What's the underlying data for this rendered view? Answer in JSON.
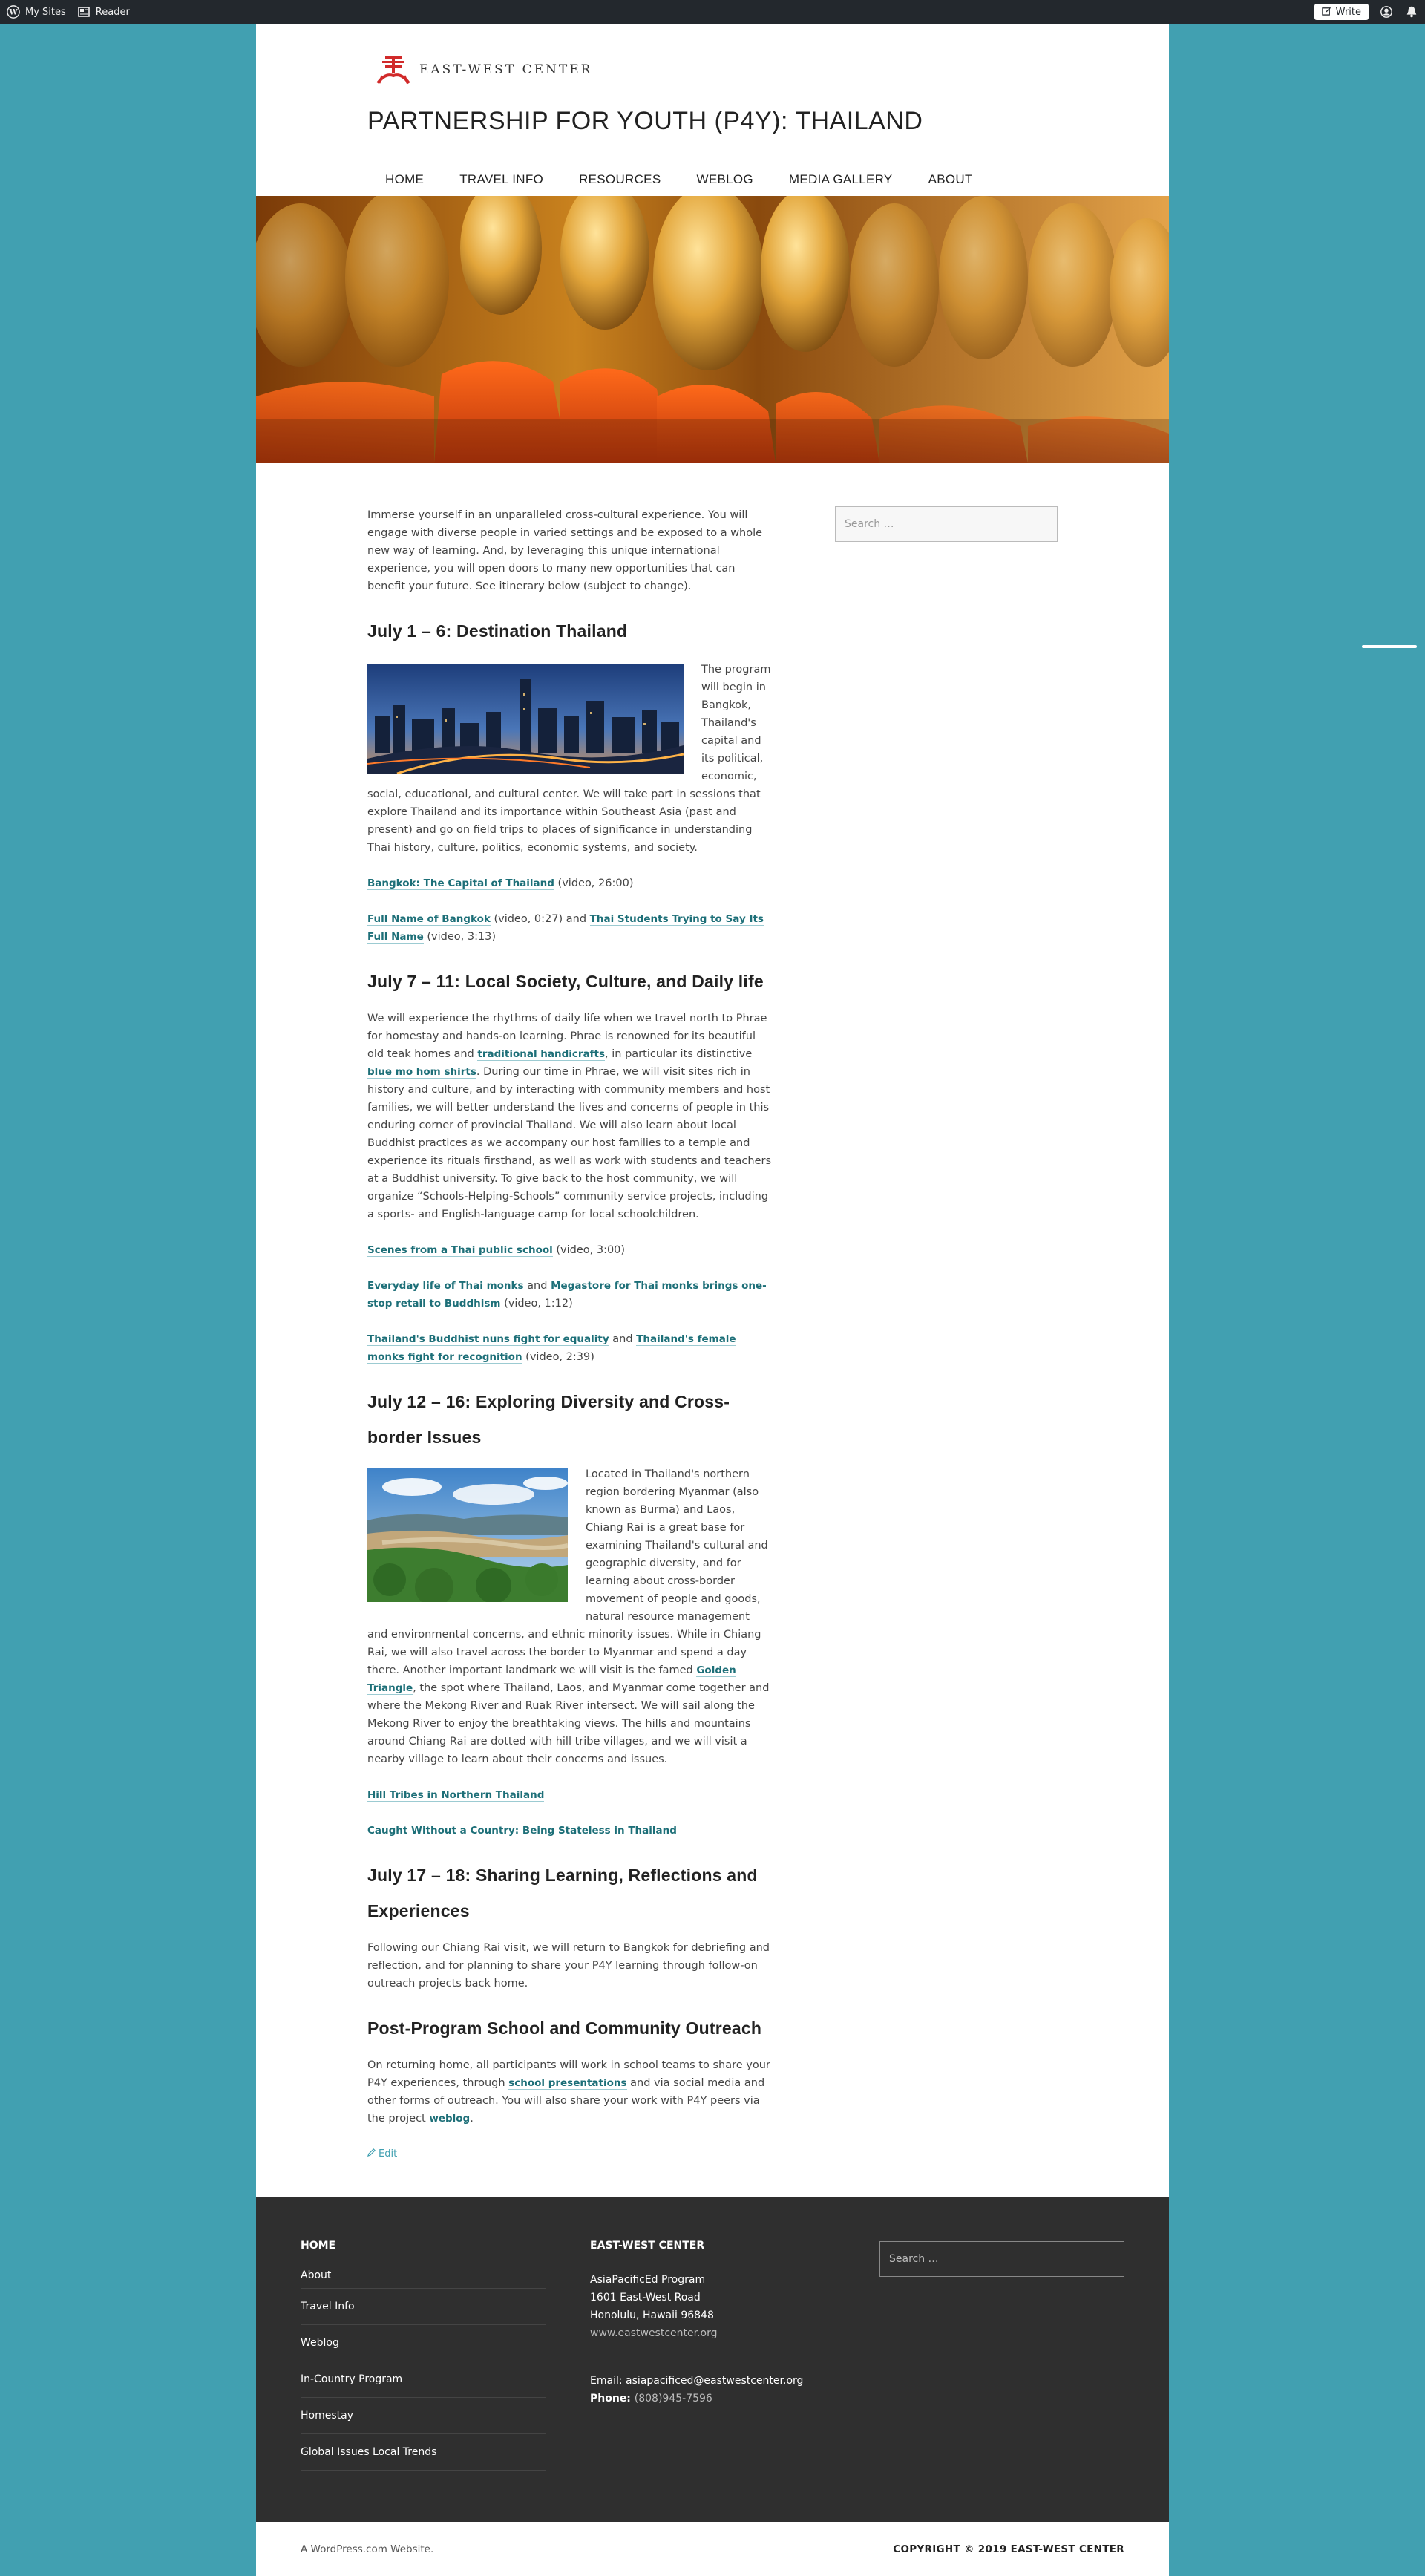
{
  "adminbar": {
    "my_sites": "My Sites",
    "reader": "Reader",
    "write": "Write"
  },
  "header": {
    "logo_text": "EAST-WEST CENTER",
    "site_title": "PARTNERSHIP FOR YOUTH (P4Y): THAILAND",
    "nav": [
      "HOME",
      "TRAVEL INFO",
      "RESOURCES",
      "WEBLOG",
      "MEDIA GALLERY",
      "ABOUT"
    ]
  },
  "content": {
    "intro": "Immerse yourself in an unparalleled cross-cultural experience. You will engage with diverse people in varied settings and be exposed to a whole new way of learning. And, by leveraging this unique international experience, you will open doors to many new opportunities that can benefit your future. See itinerary below (subject to change).",
    "s1": {
      "title": "July 1 – 6: Destination Thailand",
      "body": "The program will begin in Bangkok, Thailand's capital and its political, economic, social, educational, and cultural center. We will take part in sessions that explore Thailand and its importance within Southeast Asia (past and present) and go on field trips to places of significance in understanding Thai history, culture, politics, economic systems, and society.",
      "link1": "Bangkok: The Capital of Thailand",
      "link1_meta": " (video, 26:00)",
      "link2": "Full Name of Bangkok",
      "link2_meta": " (video, 0:27) and ",
      "link3": "Thai Students Trying to Say Its Full Name",
      "link3_meta": " (video, 3:13)"
    },
    "s2": {
      "title": "July 7 – 11: Local Society, Culture, and Daily life",
      "body_a": "We will experience the rhythms of daily life when we travel north to Phrae for homestay and hands-on learning. Phrae is renowned for its beautiful old teak homes and ",
      "body_link1": "traditional handicrafts",
      "body_b": ", in particular its distinctive ",
      "body_link2": "blue mo hom shirts",
      "body_c": ". During our time in Phrae, we will visit sites rich in history and culture, and by interacting with community members and host families, we will better understand the lives and concerns of people in this enduring corner of provincial Thailand. We will also learn about local Buddhist practices as we accompany our host families to a temple and experience its rituals firsthand, as well as work with students and teachers at a Buddhist university. To give back to the host community, we will organize “Schools-Helping-Schools” community service projects, including a sports- and English-language camp for local schoolchildren.",
      "link1": "Scenes from a Thai public school",
      "link1_meta": "  (video, 3:00)",
      "link2": "Everyday life of Thai monks",
      "link2_mid": " and ",
      "link3": "Megastore for Thai monks brings one-stop retail to Buddhism",
      "link3_meta": " (video, 1:12)",
      "link4": "Thailand's Buddhist nuns fight for equality",
      "link4_mid": " and ",
      "link5": "Thailand's female monks fight for recognition",
      "link5_meta": " (video, 2:39)"
    },
    "s3": {
      "title": "July 12 – 16: Exploring Diversity and Cross-border Issues",
      "body_a": "Located in Thailand's northern region bordering Myanmar (also known as Burma) and Laos, Chiang Rai is a great base for examining Thailand's cultural and geographic diversity, and for learning about cross-border movement of people and goods, natural resource management and environmental concerns, and ethnic minority issues. While in Chiang Rai, we will also travel across the border to Myanmar and spend a day there. Another important landmark we will visit is the famed ",
      "body_link": "Golden Triangle",
      "body_b": ", the spot where Thailand, Laos, and Myanmar come together and where the Mekong River and Ruak River intersect. We will sail along the Mekong River to enjoy the breathtaking views. The hills and mountains around Chiang Rai are dotted with hill tribe villages, and we will visit a nearby village to learn about their concerns and issues.",
      "link1": "Hill Tribes in Northern Thailand",
      "link2": "Caught Without a Country: Being Stateless in Thailand"
    },
    "s4": {
      "title": "July 17 – 18: Sharing Learning, Reflections and Experiences",
      "body": "Following our Chiang Rai visit, we will return to Bangkok for debriefing and reflection, and for planning to share your P4Y learning through follow-on outreach projects back home."
    },
    "s5": {
      "title": "Post-Program School and Community Outreach",
      "body_a": "On returning home, all  participants will work in school teams to share your P4Y experiences, through ",
      "body_link1": "school presentations",
      "body_b": " and via social media and other forms of outreach. You will also share your work with P4Y peers via the project ",
      "body_link2": "weblog",
      "body_c": "."
    },
    "edit": "Edit"
  },
  "sidebar": {
    "search_placeholder": "Search …"
  },
  "footer": {
    "menu_title": "HOME",
    "menu": [
      "About",
      "Travel Info",
      "Weblog",
      "In-Country Program",
      "Homestay",
      "Global Issues Local Trends"
    ],
    "contact_title": "EAST-WEST CENTER",
    "addr1": "AsiaPacificEd Program",
    "addr2": "1601 East-West Road",
    "addr3": "Honolulu, Hawaii 96848",
    "site": "www.eastwestcenter.org",
    "email_label": "Email: ",
    "email": "asiapacificed@eastwestcenter.org",
    "phone_label": "Phone: ",
    "phone": "(808)945-7596",
    "search_placeholder": "Search …",
    "wp_link": "A WordPress.com Website.",
    "copyright": "COPYRIGHT © 2019 EAST-WEST CENTER"
  },
  "colors": {
    "background": "#41a0b1",
    "link": "#1d6f78",
    "footer": "#2f2f2f"
  }
}
